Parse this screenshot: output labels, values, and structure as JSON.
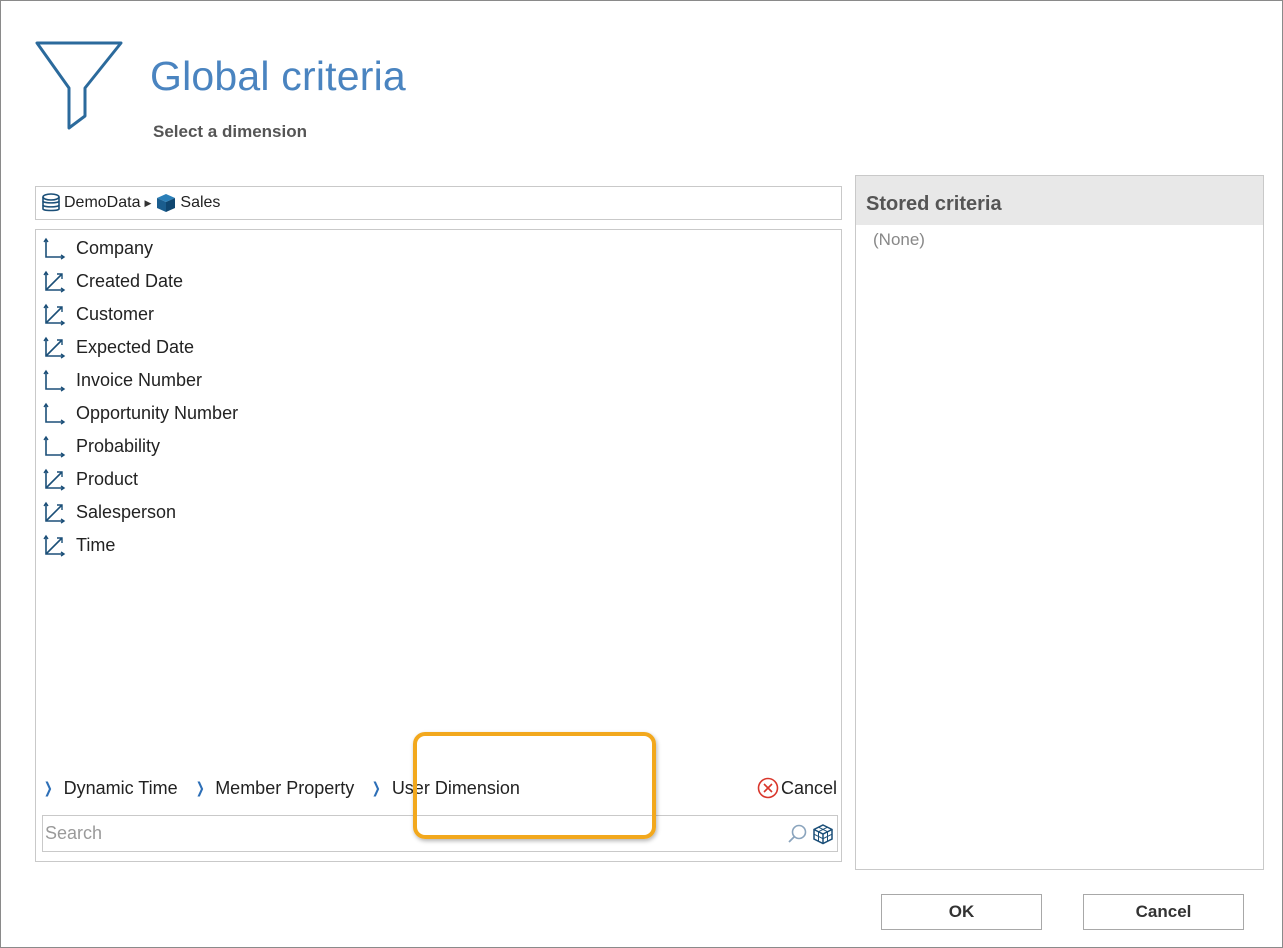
{
  "header": {
    "title": "Global criteria",
    "subtitle": "Select a dimension",
    "icon": "filter-icon"
  },
  "breadcrumb": {
    "database": "DemoData",
    "cube": "Sales"
  },
  "dimensions": [
    {
      "label": "Company",
      "icon": "flat-dimension-icon"
    },
    {
      "label": "Created Date",
      "icon": "hierarchy-dimension-icon"
    },
    {
      "label": "Customer",
      "icon": "hierarchy-dimension-icon"
    },
    {
      "label": "Expected Date",
      "icon": "hierarchy-dimension-icon"
    },
    {
      "label": "Invoice Number",
      "icon": "flat-dimension-icon"
    },
    {
      "label": "Opportunity Number",
      "icon": "flat-dimension-icon"
    },
    {
      "label": "Probability",
      "icon": "flat-dimension-icon"
    },
    {
      "label": "Product",
      "icon": "hierarchy-dimension-icon"
    },
    {
      "label": "Salesperson",
      "icon": "hierarchy-dimension-icon"
    },
    {
      "label": "Time",
      "icon": "hierarchy-dimension-icon"
    }
  ],
  "links": {
    "dynamic_time": "Dynamic Time",
    "member_property": "Member Property",
    "user_dimension": "User Dimension",
    "cancel": "Cancel"
  },
  "search": {
    "placeholder": "Search",
    "value": ""
  },
  "stored": {
    "title": "Stored criteria",
    "empty": "(None)"
  },
  "buttons": {
    "ok": "OK",
    "cancel": "Cancel"
  },
  "colors": {
    "accent": "#4a84c0",
    "link_chevron": "#2d6fb7",
    "highlight": "#f2a81d",
    "cancel_red": "#d9362b"
  }
}
